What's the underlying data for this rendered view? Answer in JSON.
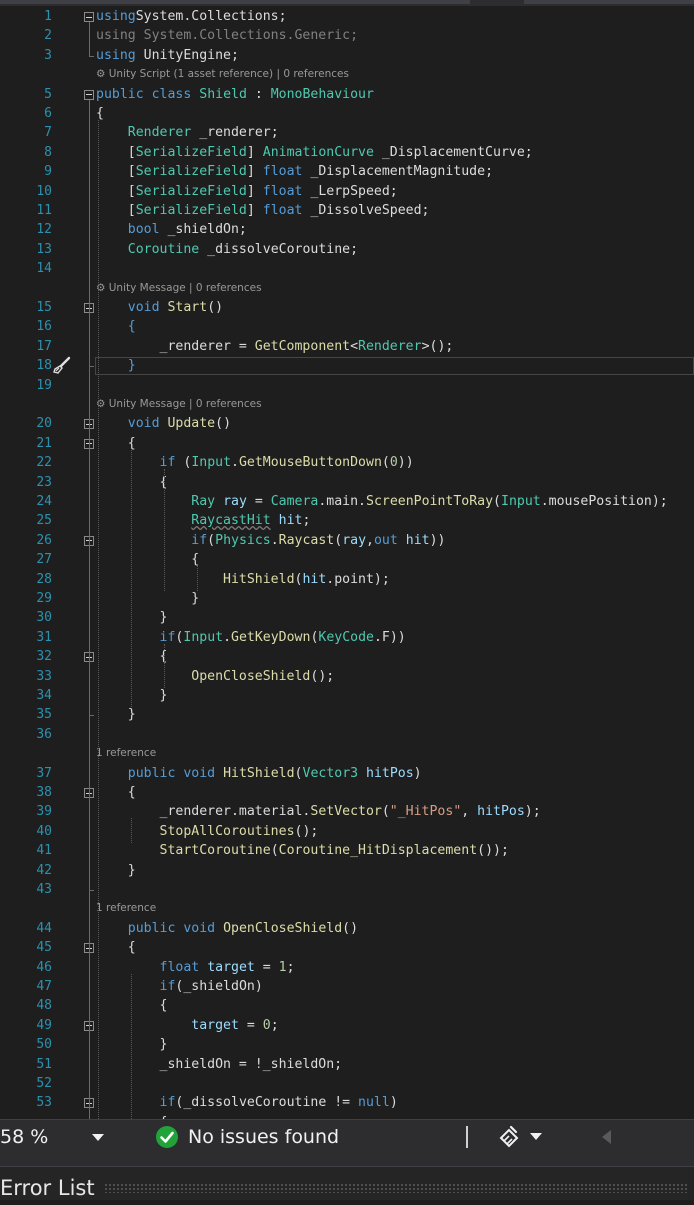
{
  "editor": {
    "lines": [
      {
        "n": "1",
        "tokens": [
          [
            "k",
            "using"
          ],
          [
            "",
            "System.Collections;"
          ]
        ]
      },
      {
        "n": "2",
        "tokens": [
          [
            "ns",
            "using System.Collections.Generic;"
          ]
        ]
      },
      {
        "n": "3",
        "tokens": [
          [
            "k",
            "using"
          ],
          [
            "",
            " UnityEngine;"
          ]
        ]
      },
      {
        "lens": "⚙ Unity Script (1 asset reference) | 0 references"
      },
      {
        "n": "5",
        "tokens": [
          [
            "k",
            "public"
          ],
          [
            "",
            " "
          ],
          [
            "k",
            "class"
          ],
          [
            "",
            " "
          ],
          [
            "t",
            "Shield"
          ],
          [
            "",
            " : "
          ],
          [
            "t",
            "MonoBehaviour"
          ]
        ]
      },
      {
        "n": "6",
        "tokens": [
          [
            "",
            "{"
          ]
        ]
      },
      {
        "n": "7",
        "tokens": [
          [
            "",
            "    "
          ],
          [
            "t",
            "Renderer"
          ],
          [
            "",
            " _renderer;"
          ]
        ]
      },
      {
        "n": "8",
        "tokens": [
          [
            "",
            "    ["
          ],
          [
            "t",
            "SerializeField"
          ],
          [
            "",
            "] "
          ],
          [
            "t",
            "AnimationCurve"
          ],
          [
            "",
            " _DisplacementCurve;"
          ]
        ]
      },
      {
        "n": "9",
        "tokens": [
          [
            "",
            "    ["
          ],
          [
            "t",
            "SerializeField"
          ],
          [
            "",
            "] "
          ],
          [
            "k",
            "float"
          ],
          [
            "",
            " _DisplacementMagnitude;"
          ]
        ]
      },
      {
        "n": "10",
        "tokens": [
          [
            "",
            "    ["
          ],
          [
            "t",
            "SerializeField"
          ],
          [
            "",
            "] "
          ],
          [
            "k",
            "float"
          ],
          [
            "",
            " _LerpSpeed;"
          ]
        ]
      },
      {
        "n": "11",
        "tokens": [
          [
            "",
            "    ["
          ],
          [
            "t",
            "SerializeField"
          ],
          [
            "",
            "] "
          ],
          [
            "k",
            "float"
          ],
          [
            "",
            " _DissolveSpeed;"
          ]
        ]
      },
      {
        "n": "12",
        "tokens": [
          [
            "",
            "    "
          ],
          [
            "k",
            "bool"
          ],
          [
            "",
            " _shieldOn;"
          ]
        ]
      },
      {
        "n": "13",
        "tokens": [
          [
            "",
            "    "
          ],
          [
            "t",
            "Coroutine"
          ],
          [
            "",
            " _dissolveCoroutine;"
          ]
        ]
      },
      {
        "n": "14",
        "tokens": []
      },
      {
        "lens": "⚙ Unity Message | 0 references"
      },
      {
        "n": "15",
        "tokens": [
          [
            "",
            "    "
          ],
          [
            "k",
            "void"
          ],
          [
            "",
            " "
          ],
          [
            "m",
            "Start"
          ],
          [
            "",
            "()"
          ]
        ]
      },
      {
        "n": "16",
        "tokens": [
          [
            "",
            "    "
          ],
          [
            "k",
            "{"
          ]
        ]
      },
      {
        "n": "17",
        "tokens": [
          [
            "",
            "        _renderer = "
          ],
          [
            "m",
            "GetComponent"
          ],
          [
            "",
            "<"
          ],
          [
            "t",
            "Renderer"
          ],
          [
            "",
            ">();"
          ]
        ]
      },
      {
        "n": "18",
        "tokens": [
          [
            "",
            "    "
          ],
          [
            "k",
            "}"
          ]
        ]
      },
      {
        "n": "19",
        "tokens": []
      },
      {
        "lens": "⚙ Unity Message | 0 references"
      },
      {
        "n": "20",
        "tokens": [
          [
            "",
            "    "
          ],
          [
            "k",
            "void"
          ],
          [
            "",
            " "
          ],
          [
            "m",
            "Update"
          ],
          [
            "",
            "()"
          ]
        ]
      },
      {
        "n": "21",
        "tokens": [
          [
            "",
            "    {"
          ]
        ]
      },
      {
        "n": "22",
        "tokens": [
          [
            "",
            "        "
          ],
          [
            "k",
            "if"
          ],
          [
            "",
            " ("
          ],
          [
            "t",
            "Input"
          ],
          [
            "",
            "."
          ],
          [
            "m",
            "GetMouseButtonDown"
          ],
          [
            "",
            "("
          ],
          [
            "n",
            "0"
          ],
          [
            "",
            "))"
          ]
        ]
      },
      {
        "n": "23",
        "tokens": [
          [
            "",
            "        {"
          ]
        ]
      },
      {
        "n": "24",
        "tokens": [
          [
            "",
            "            "
          ],
          [
            "t",
            "Ray"
          ],
          [
            "",
            " "
          ],
          [
            "v",
            "ray"
          ],
          [
            "",
            " = "
          ],
          [
            "t",
            "Camera"
          ],
          [
            "",
            ".main."
          ],
          [
            "m",
            "ScreenPointToRay"
          ],
          [
            "",
            "("
          ],
          [
            "t",
            "Input"
          ],
          [
            "",
            ".mousePosition);"
          ]
        ]
      },
      {
        "n": "25",
        "tokens": [
          [
            "",
            "            "
          ],
          [
            "t sq",
            "RaycastHit"
          ],
          [
            "",
            " "
          ],
          [
            "v",
            "hit"
          ],
          [
            "",
            ";"
          ]
        ]
      },
      {
        "n": "26",
        "tokens": [
          [
            "",
            "            "
          ],
          [
            "k",
            "if"
          ],
          [
            "",
            "("
          ],
          [
            "t",
            "Physics"
          ],
          [
            "",
            "."
          ],
          [
            "m",
            "Raycast"
          ],
          [
            "",
            "("
          ],
          [
            "v",
            "ray"
          ],
          [
            "",
            ","
          ],
          [
            "k",
            "out"
          ],
          [
            "",
            " "
          ],
          [
            "v",
            "hit"
          ],
          [
            "",
            "))"
          ]
        ]
      },
      {
        "n": "27",
        "tokens": [
          [
            "",
            "            {"
          ]
        ]
      },
      {
        "n": "28",
        "tokens": [
          [
            "",
            "                "
          ],
          [
            "m",
            "HitShield"
          ],
          [
            "",
            "("
          ],
          [
            "v",
            "hit"
          ],
          [
            "",
            ".point);"
          ]
        ]
      },
      {
        "n": "29",
        "tokens": [
          [
            "",
            "            }"
          ]
        ]
      },
      {
        "n": "30",
        "tokens": [
          [
            "",
            "        }"
          ]
        ]
      },
      {
        "n": "31",
        "tokens": [
          [
            "",
            "        "
          ],
          [
            "k",
            "if"
          ],
          [
            "",
            "("
          ],
          [
            "t",
            "Input"
          ],
          [
            "",
            "."
          ],
          [
            "m",
            "GetKeyDown"
          ],
          [
            "",
            "("
          ],
          [
            "t",
            "KeyCode"
          ],
          [
            "",
            ".F))"
          ]
        ]
      },
      {
        "n": "32",
        "tokens": [
          [
            "",
            "        {"
          ]
        ]
      },
      {
        "n": "33",
        "tokens": [
          [
            "",
            "            "
          ],
          [
            "m",
            "OpenCloseShield"
          ],
          [
            "",
            "();"
          ]
        ]
      },
      {
        "n": "34",
        "tokens": [
          [
            "",
            "        }"
          ]
        ]
      },
      {
        "n": "35",
        "tokens": [
          [
            "",
            "    }"
          ]
        ]
      },
      {
        "n": "36",
        "tokens": []
      },
      {
        "lens": "1 reference"
      },
      {
        "n": "37",
        "tokens": [
          [
            "",
            "    "
          ],
          [
            "k",
            "public"
          ],
          [
            "",
            " "
          ],
          [
            "k",
            "void"
          ],
          [
            "",
            " "
          ],
          [
            "m",
            "HitShield"
          ],
          [
            "",
            "("
          ],
          [
            "t",
            "Vector3"
          ],
          [
            "",
            " "
          ],
          [
            "v",
            "hitPos"
          ],
          [
            "",
            ")"
          ]
        ]
      },
      {
        "n": "38",
        "tokens": [
          [
            "",
            "    {"
          ]
        ]
      },
      {
        "n": "39",
        "tokens": [
          [
            "",
            "        _renderer.material."
          ],
          [
            "m",
            "SetVector"
          ],
          [
            "",
            "("
          ],
          [
            "s",
            "\"_HitPos\""
          ],
          [
            "",
            ", "
          ],
          [
            "v",
            "hitPos"
          ],
          [
            "",
            ");"
          ]
        ]
      },
      {
        "n": "40",
        "tokens": [
          [
            "",
            "        "
          ],
          [
            "m",
            "StopAllCoroutines"
          ],
          [
            "",
            "();"
          ]
        ]
      },
      {
        "n": "41",
        "tokens": [
          [
            "",
            "        "
          ],
          [
            "m",
            "StartCoroutine"
          ],
          [
            "",
            "("
          ],
          [
            "m",
            "Coroutine_HitDisplacement"
          ],
          [
            "",
            "());"
          ]
        ]
      },
      {
        "n": "42",
        "tokens": [
          [
            "",
            "    }"
          ]
        ]
      },
      {
        "n": "43",
        "tokens": []
      },
      {
        "lens": "1 reference"
      },
      {
        "n": "44",
        "tokens": [
          [
            "",
            "    "
          ],
          [
            "k",
            "public"
          ],
          [
            "",
            " "
          ],
          [
            "k",
            "void"
          ],
          [
            "",
            " "
          ],
          [
            "m",
            "OpenCloseShield"
          ],
          [
            "",
            "()"
          ]
        ]
      },
      {
        "n": "45",
        "tokens": [
          [
            "",
            "    {"
          ]
        ]
      },
      {
        "n": "46",
        "tokens": [
          [
            "",
            "        "
          ],
          [
            "k",
            "float"
          ],
          [
            "",
            " "
          ],
          [
            "v",
            "target"
          ],
          [
            "",
            " = "
          ],
          [
            "n",
            "1"
          ],
          [
            "",
            ";"
          ]
        ]
      },
      {
        "n": "47",
        "tokens": [
          [
            "",
            "        "
          ],
          [
            "k",
            "if"
          ],
          [
            "",
            "(_shieldOn)"
          ]
        ]
      },
      {
        "n": "48",
        "tokens": [
          [
            "",
            "        {"
          ]
        ]
      },
      {
        "n": "49",
        "tokens": [
          [
            "",
            "            "
          ],
          [
            "v",
            "target"
          ],
          [
            "",
            " = "
          ],
          [
            "n",
            "0"
          ],
          [
            "",
            ";"
          ]
        ]
      },
      {
        "n": "50",
        "tokens": [
          [
            "",
            "        }"
          ]
        ]
      },
      {
        "n": "51",
        "tokens": [
          [
            "",
            "        _shieldOn = !_shieldOn;"
          ]
        ]
      },
      {
        "n": "52",
        "tokens": []
      },
      {
        "n": "53",
        "tokens": [
          [
            "",
            "        "
          ],
          [
            "k",
            "if"
          ],
          [
            "",
            "(_dissolveCoroutine != "
          ],
          [
            "k",
            "null"
          ],
          [
            "",
            ")"
          ]
        ]
      },
      {
        "n": "",
        "tokens": [
          [
            "",
            "        {"
          ]
        ]
      }
    ]
  },
  "statusbar": {
    "zoom": "58 %",
    "issues": "No issues found"
  },
  "error_list": {
    "title": "Error List"
  },
  "colors": {
    "line_number": "#2b91af",
    "keyword": "#569cd6",
    "type": "#4ec9b0",
    "method": "#dcdcaa",
    "variable": "#9cdcfe",
    "string": "#d69d85",
    "number": "#b5cea8",
    "ok_green": "#22a33a"
  }
}
